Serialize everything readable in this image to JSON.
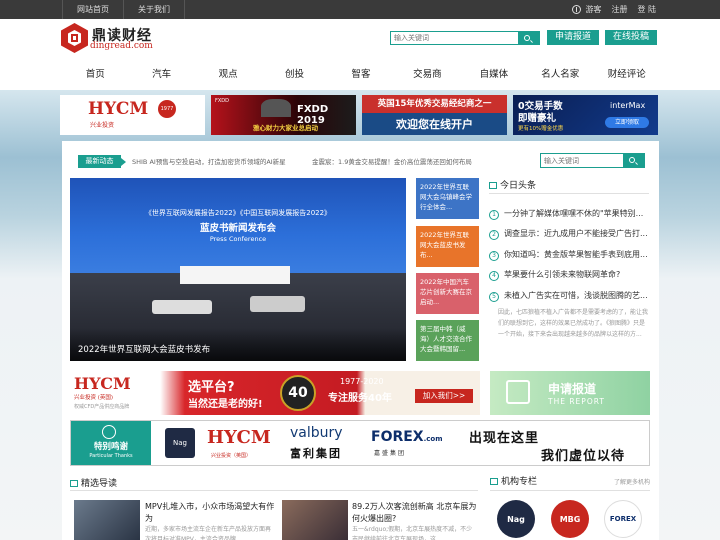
{
  "topbar": {
    "home": "网站首页",
    "about": "关于我们",
    "guest": "游客",
    "register": "注册",
    "login": "登 陆"
  },
  "logo": {
    "cn": "鼎读财经",
    "en": "dingread.com"
  },
  "header": {
    "search_placeholder": "输入关键词",
    "apply_report": "申请报道",
    "online_submit": "在线投稿"
  },
  "nav": [
    "首页",
    "汽车",
    "观点",
    "创投",
    "智客",
    "交易商",
    "自媒体",
    "名人名家",
    "财经评论"
  ],
  "top_ads": {
    "hycm": {
      "brand": "HYCM",
      "sub": "兴业投资",
      "year": "1977"
    },
    "fxdd": {
      "brand": "FXDD",
      "year": "2019",
      "slogan": "雅心财力大家业总启动"
    },
    "uk": {
      "line1": "英国15年优秀交易经纪商之一",
      "line2": "欢迎您在线开户"
    },
    "intermax": {
      "line1": "0交易手数",
      "line2": "即赠豪礼",
      "line3": "更有10%赠金优惠",
      "brand": "interMax",
      "btn": "立即领取"
    }
  },
  "newsbar": {
    "badge": "最新动态",
    "items": [
      "SHIB AI预售与空投启动，打造加密货币领域的AI新星",
      "金震宸：1.9黄金交易提醒！金价高位震荡还回如何布局"
    ],
    "search_placeholder": "输入关键词"
  },
  "hero": {
    "caption": "2022年世界互联网大会蓝皮书发布",
    "screen_line1": "《世界互联网发展报告2022》《中国互联网发展报告2022》",
    "screen_line2": "蓝皮书新闻发布会",
    "screen_line3": "Press Conference"
  },
  "tiles": [
    {
      "text": "2022年世界互联网大会乌镇峰会学行全体会..."
    },
    {
      "text": "2022年世界互联网大会蓝皮书发布..."
    },
    {
      "text": "2022年中国汽车芯片创新大赛在京启动..."
    },
    {
      "text": "第三届中韩（威海）人才交流合作大会暨韩国留..."
    }
  ],
  "headlines": {
    "title": "今日头条",
    "items": [
      {
        "num": "1",
        "text": "一分钟了解媒体嘿嘿不休的\"苹果特别..."
      },
      {
        "num": "2",
        "text": "调查显示：近九成用户不能接受广告打..."
      },
      {
        "num": "3",
        "text": "你知道吗：黄金版苹果智能手表到底用..."
      },
      {
        "num": "4",
        "text": "苹果要什么引领未来物联网革命?"
      },
      {
        "num": "5",
        "text": "未植入广告实在可惜，浅谈脱图腾的艺..."
      }
    ],
    "desc": "因此，七匹狼植不植入广告都不是需要考虑的了，能让我们的联想到它，这样的效果已然成功了。《狼图腾》只是一个开始，接下来会出现越来越多的品牌以这样的方..."
  },
  "mid_ads": {
    "hycm": {
      "brand": "HYCM",
      "sub": "兴业投资 (英国)",
      "small": "权威CFD产品供应商品牌"
    },
    "platform": {
      "line1": "选平台?",
      "line2": "当然还是老的好!",
      "years": "1977-2020",
      "line3": "专注服务40年",
      "badge": "40",
      "join": "加入我们>>"
    },
    "report": {
      "cn": "申请报道",
      "en": "THE REPORT"
    }
  },
  "thanks": {
    "title": "特别鸣谢",
    "sub": "Particular Thanks",
    "logos": {
      "nag": "Nag",
      "hycm": "HYCM",
      "hycm_sub": "兴业投资（英国）",
      "valbury": "valbury",
      "valbury_cn": "富利集团",
      "forex": "FOREX",
      "forex_dot": ".com",
      "forex_cn": "嘉盛集团"
    },
    "slogan1": "出现在这里",
    "slogan2": "我们虚位以待"
  },
  "selected": {
    "title": "精选导读"
  },
  "cards": [
    {
      "title": "MPV扎堆入市，小众市场渴望大有作为",
      "desc": "近期，多家市场主流车企在新车产品投放方面再次将目标对准MPV，主流合资品牌..."
    },
    {
      "title": "89.2万人次客流创新高 北京车展为何火爆出圈?",
      "desc": "五一&rdquo;假期，北京车展热度不减，不少市民继续前往北京车展现场，这..."
    }
  ],
  "columns": {
    "title": "机构专栏",
    "more": "了解更多机构",
    "orgs": [
      "Nag",
      "MBG",
      "FOREX"
    ]
  },
  "colors": {
    "accent": "#1a9e8f",
    "topbar": "#3a3a3a",
    "brand_red": "#c7271f"
  }
}
